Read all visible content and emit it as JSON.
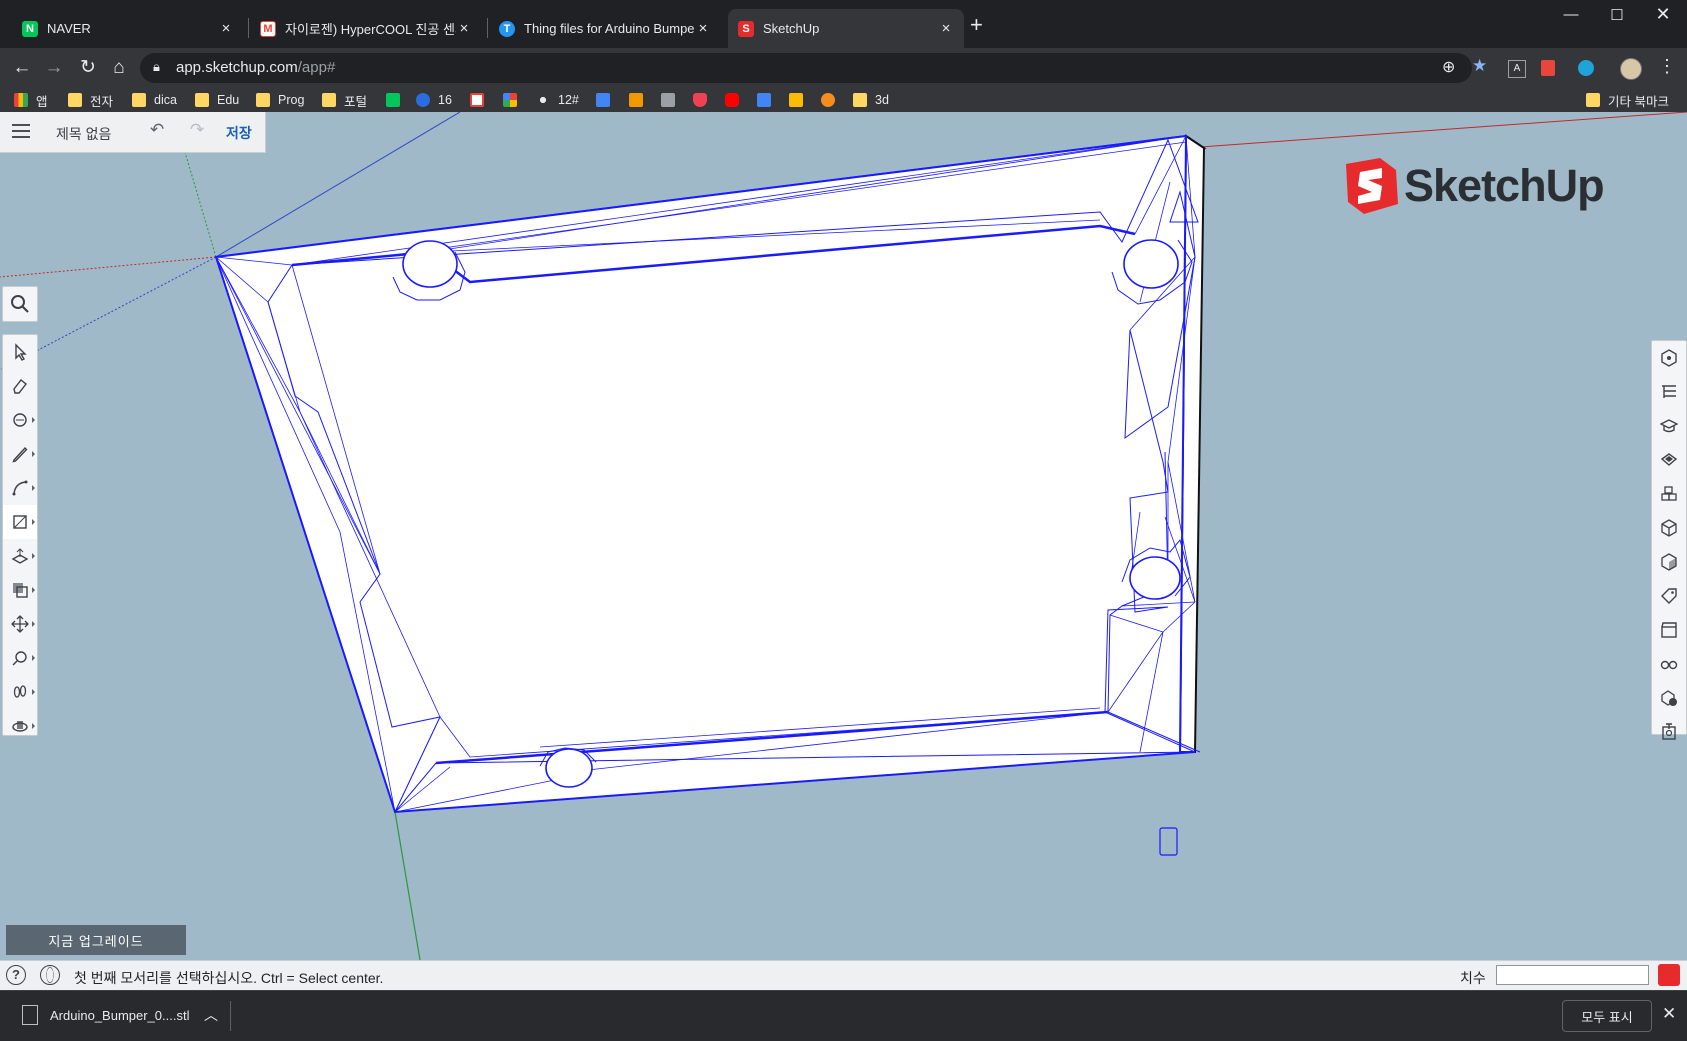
{
  "browser": {
    "tabs": [
      {
        "label": "NAVER",
        "favicon": "naver-icon",
        "color": "#03c75a",
        "active": false
      },
      {
        "label": "자이로젠) HyperCOOL 진공 센서",
        "favicon": "gmail-icon",
        "color": "#ea4335",
        "active": false
      },
      {
        "label": "Thing files for Arduino Bumper",
        "favicon": "thingiverse-icon",
        "color": "#2196f3",
        "active": false
      },
      {
        "label": "SketchUp",
        "favicon": "sketchup-icon",
        "color": "#e72b2d",
        "active": true
      }
    ],
    "url_host": "app.sketchup.com",
    "url_path": "/app#",
    "bookmarks": [
      {
        "label": "앱",
        "icon": "apps-grid-icon"
      },
      {
        "label": "전자",
        "icon": "folder-icon"
      },
      {
        "label": "dica",
        "icon": "folder-icon"
      },
      {
        "label": "Edu",
        "icon": "folder-icon"
      },
      {
        "label": "Prog",
        "icon": "folder-icon"
      },
      {
        "label": "포털",
        "icon": "folder-icon"
      },
      {
        "label": "",
        "icon": "naver-icon"
      },
      {
        "label": "16",
        "icon": "d-icon"
      },
      {
        "label": "",
        "icon": "gmail-icon"
      },
      {
        "label": "",
        "icon": "pinwheel-icon"
      },
      {
        "label": "12#",
        "icon": "dots-icon"
      },
      {
        "label": "",
        "icon": "calendar-icon"
      },
      {
        "label": "",
        "icon": "r-icon"
      },
      {
        "label": "",
        "icon": "printer-icon"
      },
      {
        "label": "",
        "icon": "pocket-icon"
      },
      {
        "label": "",
        "icon": "youtube-icon"
      },
      {
        "label": "",
        "icon": "translate-icon"
      },
      {
        "label": "",
        "icon": "maps-icon"
      },
      {
        "label": "",
        "icon": "orange-icon"
      },
      {
        "label": "3d",
        "icon": "folder-icon"
      }
    ],
    "other_bookmarks": "기타 북마크"
  },
  "app": {
    "doc_title": "제목 없음",
    "save_label": "저장",
    "undo_icon": "undo-icon",
    "redo_icon": "redo-icon",
    "upgrade_label": "지금 업그레이드",
    "logo_text": "SketchUp",
    "status_text": "첫 번째 모서리를 선택하십시오. Ctrl = Select center.",
    "dimension_label": "치수",
    "dimension_value": "",
    "left_tools": [
      "search",
      "select",
      "eraser",
      "paint",
      "pencil",
      "arc",
      "rectangle",
      "push-pull",
      "offset",
      "move",
      "tape-measure",
      "walk",
      "orbit"
    ],
    "selected_tool": "rectangle",
    "right_panels": [
      "entity-info",
      "outliner",
      "instructor",
      "materials",
      "components",
      "styles",
      "views",
      "tags",
      "scenes",
      "display",
      "model-info",
      "solid-inspector"
    ]
  },
  "downloads": {
    "file_name": "Arduino_Bumper_0....stl",
    "show_all_label": "모두 표시"
  }
}
